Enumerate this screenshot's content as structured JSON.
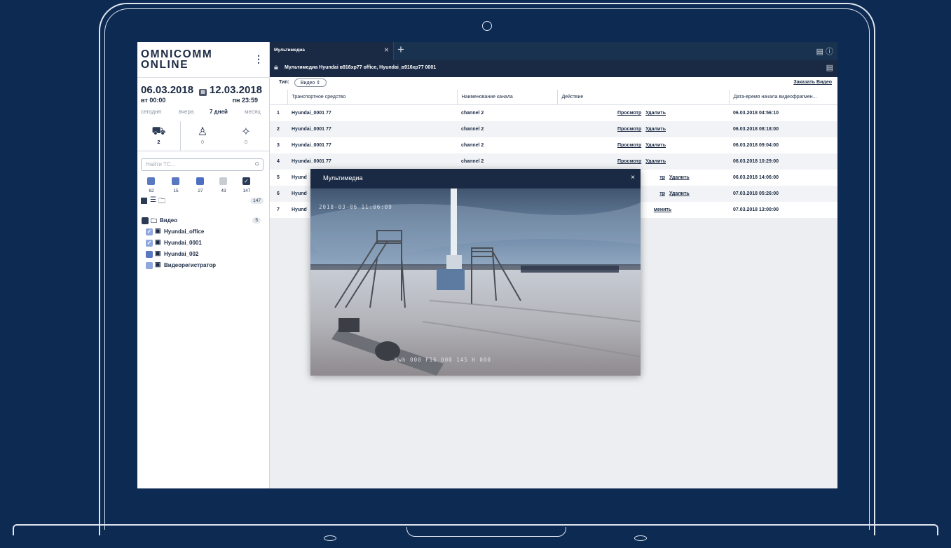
{
  "app": {
    "logo_line1": "OMNICOMM",
    "logo_line2": "ONLINE",
    "menu_icon": "kebab-icon"
  },
  "period": {
    "start_date": "06.03.2018",
    "start_time": "вт 00:00",
    "end_date": "12.03.2018",
    "end_time": "пн 23:59",
    "calendar_icon": "calendar-icon",
    "quick": [
      "сегодня",
      "вчера",
      "7 дней",
      "месяц"
    ],
    "quick_active": "7 дней"
  },
  "object_tabs": [
    {
      "icon": "truck-icon",
      "count": "2"
    },
    {
      "icon": "driver-icon",
      "count": "0"
    },
    {
      "icon": "geozone-icon",
      "count": "0"
    }
  ],
  "search": {
    "placeholder": "Найти ТС..."
  },
  "status_filters": [
    {
      "color": "#5a78c2",
      "count": "62"
    },
    {
      "color": "#5a78c2",
      "count": "15"
    },
    {
      "color": "#4d6fc3",
      "count": "27"
    },
    {
      "color": "#c9ccd3",
      "count": "43"
    },
    {
      "color": "#2b3a55",
      "count": "147",
      "checked": true
    }
  ],
  "list_toolbar": {
    "count": "147"
  },
  "tree": {
    "root": {
      "label": "Видео",
      "count": "5"
    },
    "items": [
      {
        "label": "Hyundai_office",
        "checked": true
      },
      {
        "label": "Hyundai_0001",
        "checked": true
      },
      {
        "label": "Hyundai_002",
        "checked": false
      },
      {
        "label": "Видеорегистратор",
        "checked": false
      }
    ]
  },
  "tabbar": {
    "tab_label": "Мультимедиа",
    "icons": [
      "chat-icon",
      "help-icon"
    ]
  },
  "subbar": {
    "title": "Мультимедиа   Hyundai в916хр77 office, Hyundai_в916хр77 0001"
  },
  "type_filter": {
    "label": "Тип:",
    "value": "Видео",
    "order_link": "Заказать Видео"
  },
  "table": {
    "columns": [
      "Транспортное средство",
      "Наименование канала",
      "Действие",
      "Дата-время начала видеофрагмен..."
    ],
    "rows": [
      {
        "n": "1",
        "vehicle": "Hyundai_0001   77",
        "channel": "channel 2",
        "view": "Просмотр",
        "del": "Удалить",
        "dt": "06.03.2018 04:56:10"
      },
      {
        "n": "2",
        "vehicle": "Hyundai_0001   77",
        "channel": "channel 2",
        "view": "Просмотр",
        "del": "Удалить",
        "dt": "06.03.2018 08:18:00"
      },
      {
        "n": "3",
        "vehicle": "Hyundai_0001   77",
        "channel": "channel 2",
        "view": "Просмотр",
        "del": "Удалить",
        "dt": "06.03.2018 09:04:00"
      },
      {
        "n": "4",
        "vehicle": "Hyundai_0001   77",
        "channel": "channel 2",
        "view": "Просмотр",
        "del": "Удалить",
        "dt": "06.03.2018 10:29:00"
      },
      {
        "n": "5",
        "vehicle": "Hyund",
        "channel": "",
        "view": "тр",
        "del": "Удалить",
        "dt": "06.03.2018 14:06:00"
      },
      {
        "n": "6",
        "vehicle": "Hyund",
        "channel": "",
        "view": "тр",
        "del": "Удалить",
        "dt": "07.03.2018 05:26:00"
      },
      {
        "n": "7",
        "vehicle": "Hyund",
        "channel": "",
        "view": "",
        "del": "менить",
        "dt": "07.03.2018 13:00:00"
      }
    ]
  },
  "modal": {
    "title": "Мультимедиа",
    "close": "×",
    "video_timestamp": "2018-03-06  11:06:09",
    "video_caption": "Kwh 000 F16 000 145 H 000"
  }
}
